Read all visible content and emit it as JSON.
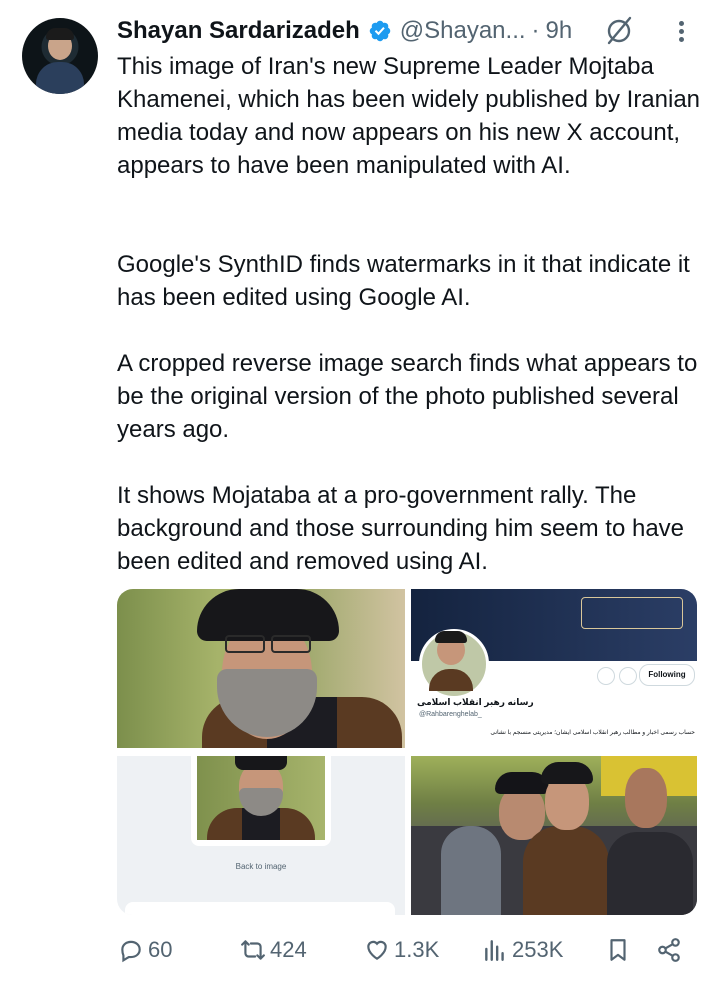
{
  "tweet": {
    "author_name": "Shayan Sardarizadeh",
    "handle": "@Shayan...",
    "separator": "·",
    "time": "9h",
    "paragraphs": [
      "This image of Iran's new Supreme Leader Mojtaba Khamenei, which has been widely published by Iranian media today and now appears on his new X account, appears to have been manipulated with AI.",
      "Google's SynthID finds watermarks in it that indicate it has been edited using Google AI.",
      "A cropped reverse image search finds what appears to be the original version of the photo published several years ago.",
      "It shows Mojataba at a pro-government rally. The background and those surrounding him seem to have been edited and removed using AI."
    ]
  },
  "media": {
    "profile_card": {
      "name": "رسانه رهبر انقلاب اسلامی",
      "handle": "@Rahbarenghelab_",
      "button": "Following",
      "bio": "حساب رسمی اخبار و مطالب رهبر انقلاب اسلامی ایشان؛ مدیریتی منسجم با نشانی"
    },
    "search_result_link": "Back to image"
  },
  "actions": {
    "replies": "60",
    "reposts": "424",
    "likes": "1.3K",
    "views": "253K"
  },
  "colors": {
    "verified": "#1d9bf0",
    "secondary_text": "#536471",
    "primary_text": "#0f1419"
  },
  "icons": [
    "verified-badge-icon",
    "grok-icon",
    "more-options-icon",
    "reply-icon",
    "repost-icon",
    "like-icon",
    "views-icon",
    "bookmark-icon",
    "share-icon"
  ]
}
